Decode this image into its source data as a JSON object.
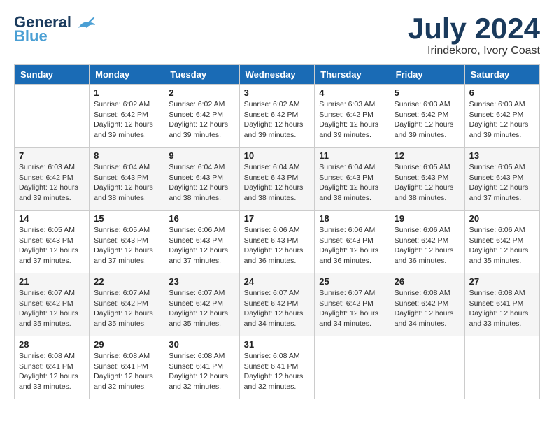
{
  "header": {
    "logo_line1": "General",
    "logo_line2": "Blue",
    "month": "July 2024",
    "location": "Irindekoro, Ivory Coast"
  },
  "days_of_week": [
    "Sunday",
    "Monday",
    "Tuesday",
    "Wednesday",
    "Thursday",
    "Friday",
    "Saturday"
  ],
  "weeks": [
    [
      {
        "day": "",
        "info": ""
      },
      {
        "day": "1",
        "info": "Sunrise: 6:02 AM\nSunset: 6:42 PM\nDaylight: 12 hours\nand 39 minutes."
      },
      {
        "day": "2",
        "info": "Sunrise: 6:02 AM\nSunset: 6:42 PM\nDaylight: 12 hours\nand 39 minutes."
      },
      {
        "day": "3",
        "info": "Sunrise: 6:02 AM\nSunset: 6:42 PM\nDaylight: 12 hours\nand 39 minutes."
      },
      {
        "day": "4",
        "info": "Sunrise: 6:03 AM\nSunset: 6:42 PM\nDaylight: 12 hours\nand 39 minutes."
      },
      {
        "day": "5",
        "info": "Sunrise: 6:03 AM\nSunset: 6:42 PM\nDaylight: 12 hours\nand 39 minutes."
      },
      {
        "day": "6",
        "info": "Sunrise: 6:03 AM\nSunset: 6:42 PM\nDaylight: 12 hours\nand 39 minutes."
      }
    ],
    [
      {
        "day": "7",
        "info": "Sunrise: 6:03 AM\nSunset: 6:42 PM\nDaylight: 12 hours\nand 39 minutes."
      },
      {
        "day": "8",
        "info": "Sunrise: 6:04 AM\nSunset: 6:43 PM\nDaylight: 12 hours\nand 38 minutes."
      },
      {
        "day": "9",
        "info": "Sunrise: 6:04 AM\nSunset: 6:43 PM\nDaylight: 12 hours\nand 38 minutes."
      },
      {
        "day": "10",
        "info": "Sunrise: 6:04 AM\nSunset: 6:43 PM\nDaylight: 12 hours\nand 38 minutes."
      },
      {
        "day": "11",
        "info": "Sunrise: 6:04 AM\nSunset: 6:43 PM\nDaylight: 12 hours\nand 38 minutes."
      },
      {
        "day": "12",
        "info": "Sunrise: 6:05 AM\nSunset: 6:43 PM\nDaylight: 12 hours\nand 38 minutes."
      },
      {
        "day": "13",
        "info": "Sunrise: 6:05 AM\nSunset: 6:43 PM\nDaylight: 12 hours\nand 37 minutes."
      }
    ],
    [
      {
        "day": "14",
        "info": "Sunrise: 6:05 AM\nSunset: 6:43 PM\nDaylight: 12 hours\nand 37 minutes."
      },
      {
        "day": "15",
        "info": "Sunrise: 6:05 AM\nSunset: 6:43 PM\nDaylight: 12 hours\nand 37 minutes."
      },
      {
        "day": "16",
        "info": "Sunrise: 6:06 AM\nSunset: 6:43 PM\nDaylight: 12 hours\nand 37 minutes."
      },
      {
        "day": "17",
        "info": "Sunrise: 6:06 AM\nSunset: 6:43 PM\nDaylight: 12 hours\nand 36 minutes."
      },
      {
        "day": "18",
        "info": "Sunrise: 6:06 AM\nSunset: 6:43 PM\nDaylight: 12 hours\nand 36 minutes."
      },
      {
        "day": "19",
        "info": "Sunrise: 6:06 AM\nSunset: 6:42 PM\nDaylight: 12 hours\nand 36 minutes."
      },
      {
        "day": "20",
        "info": "Sunrise: 6:06 AM\nSunset: 6:42 PM\nDaylight: 12 hours\nand 35 minutes."
      }
    ],
    [
      {
        "day": "21",
        "info": "Sunrise: 6:07 AM\nSunset: 6:42 PM\nDaylight: 12 hours\nand 35 minutes."
      },
      {
        "day": "22",
        "info": "Sunrise: 6:07 AM\nSunset: 6:42 PM\nDaylight: 12 hours\nand 35 minutes."
      },
      {
        "day": "23",
        "info": "Sunrise: 6:07 AM\nSunset: 6:42 PM\nDaylight: 12 hours\nand 35 minutes."
      },
      {
        "day": "24",
        "info": "Sunrise: 6:07 AM\nSunset: 6:42 PM\nDaylight: 12 hours\nand 34 minutes."
      },
      {
        "day": "25",
        "info": "Sunrise: 6:07 AM\nSunset: 6:42 PM\nDaylight: 12 hours\nand 34 minutes."
      },
      {
        "day": "26",
        "info": "Sunrise: 6:08 AM\nSunset: 6:42 PM\nDaylight: 12 hours\nand 34 minutes."
      },
      {
        "day": "27",
        "info": "Sunrise: 6:08 AM\nSunset: 6:41 PM\nDaylight: 12 hours\nand 33 minutes."
      }
    ],
    [
      {
        "day": "28",
        "info": "Sunrise: 6:08 AM\nSunset: 6:41 PM\nDaylight: 12 hours\nand 33 minutes."
      },
      {
        "day": "29",
        "info": "Sunrise: 6:08 AM\nSunset: 6:41 PM\nDaylight: 12 hours\nand 32 minutes."
      },
      {
        "day": "30",
        "info": "Sunrise: 6:08 AM\nSunset: 6:41 PM\nDaylight: 12 hours\nand 32 minutes."
      },
      {
        "day": "31",
        "info": "Sunrise: 6:08 AM\nSunset: 6:41 PM\nDaylight: 12 hours\nand 32 minutes."
      },
      {
        "day": "",
        "info": ""
      },
      {
        "day": "",
        "info": ""
      },
      {
        "day": "",
        "info": ""
      }
    ]
  ]
}
